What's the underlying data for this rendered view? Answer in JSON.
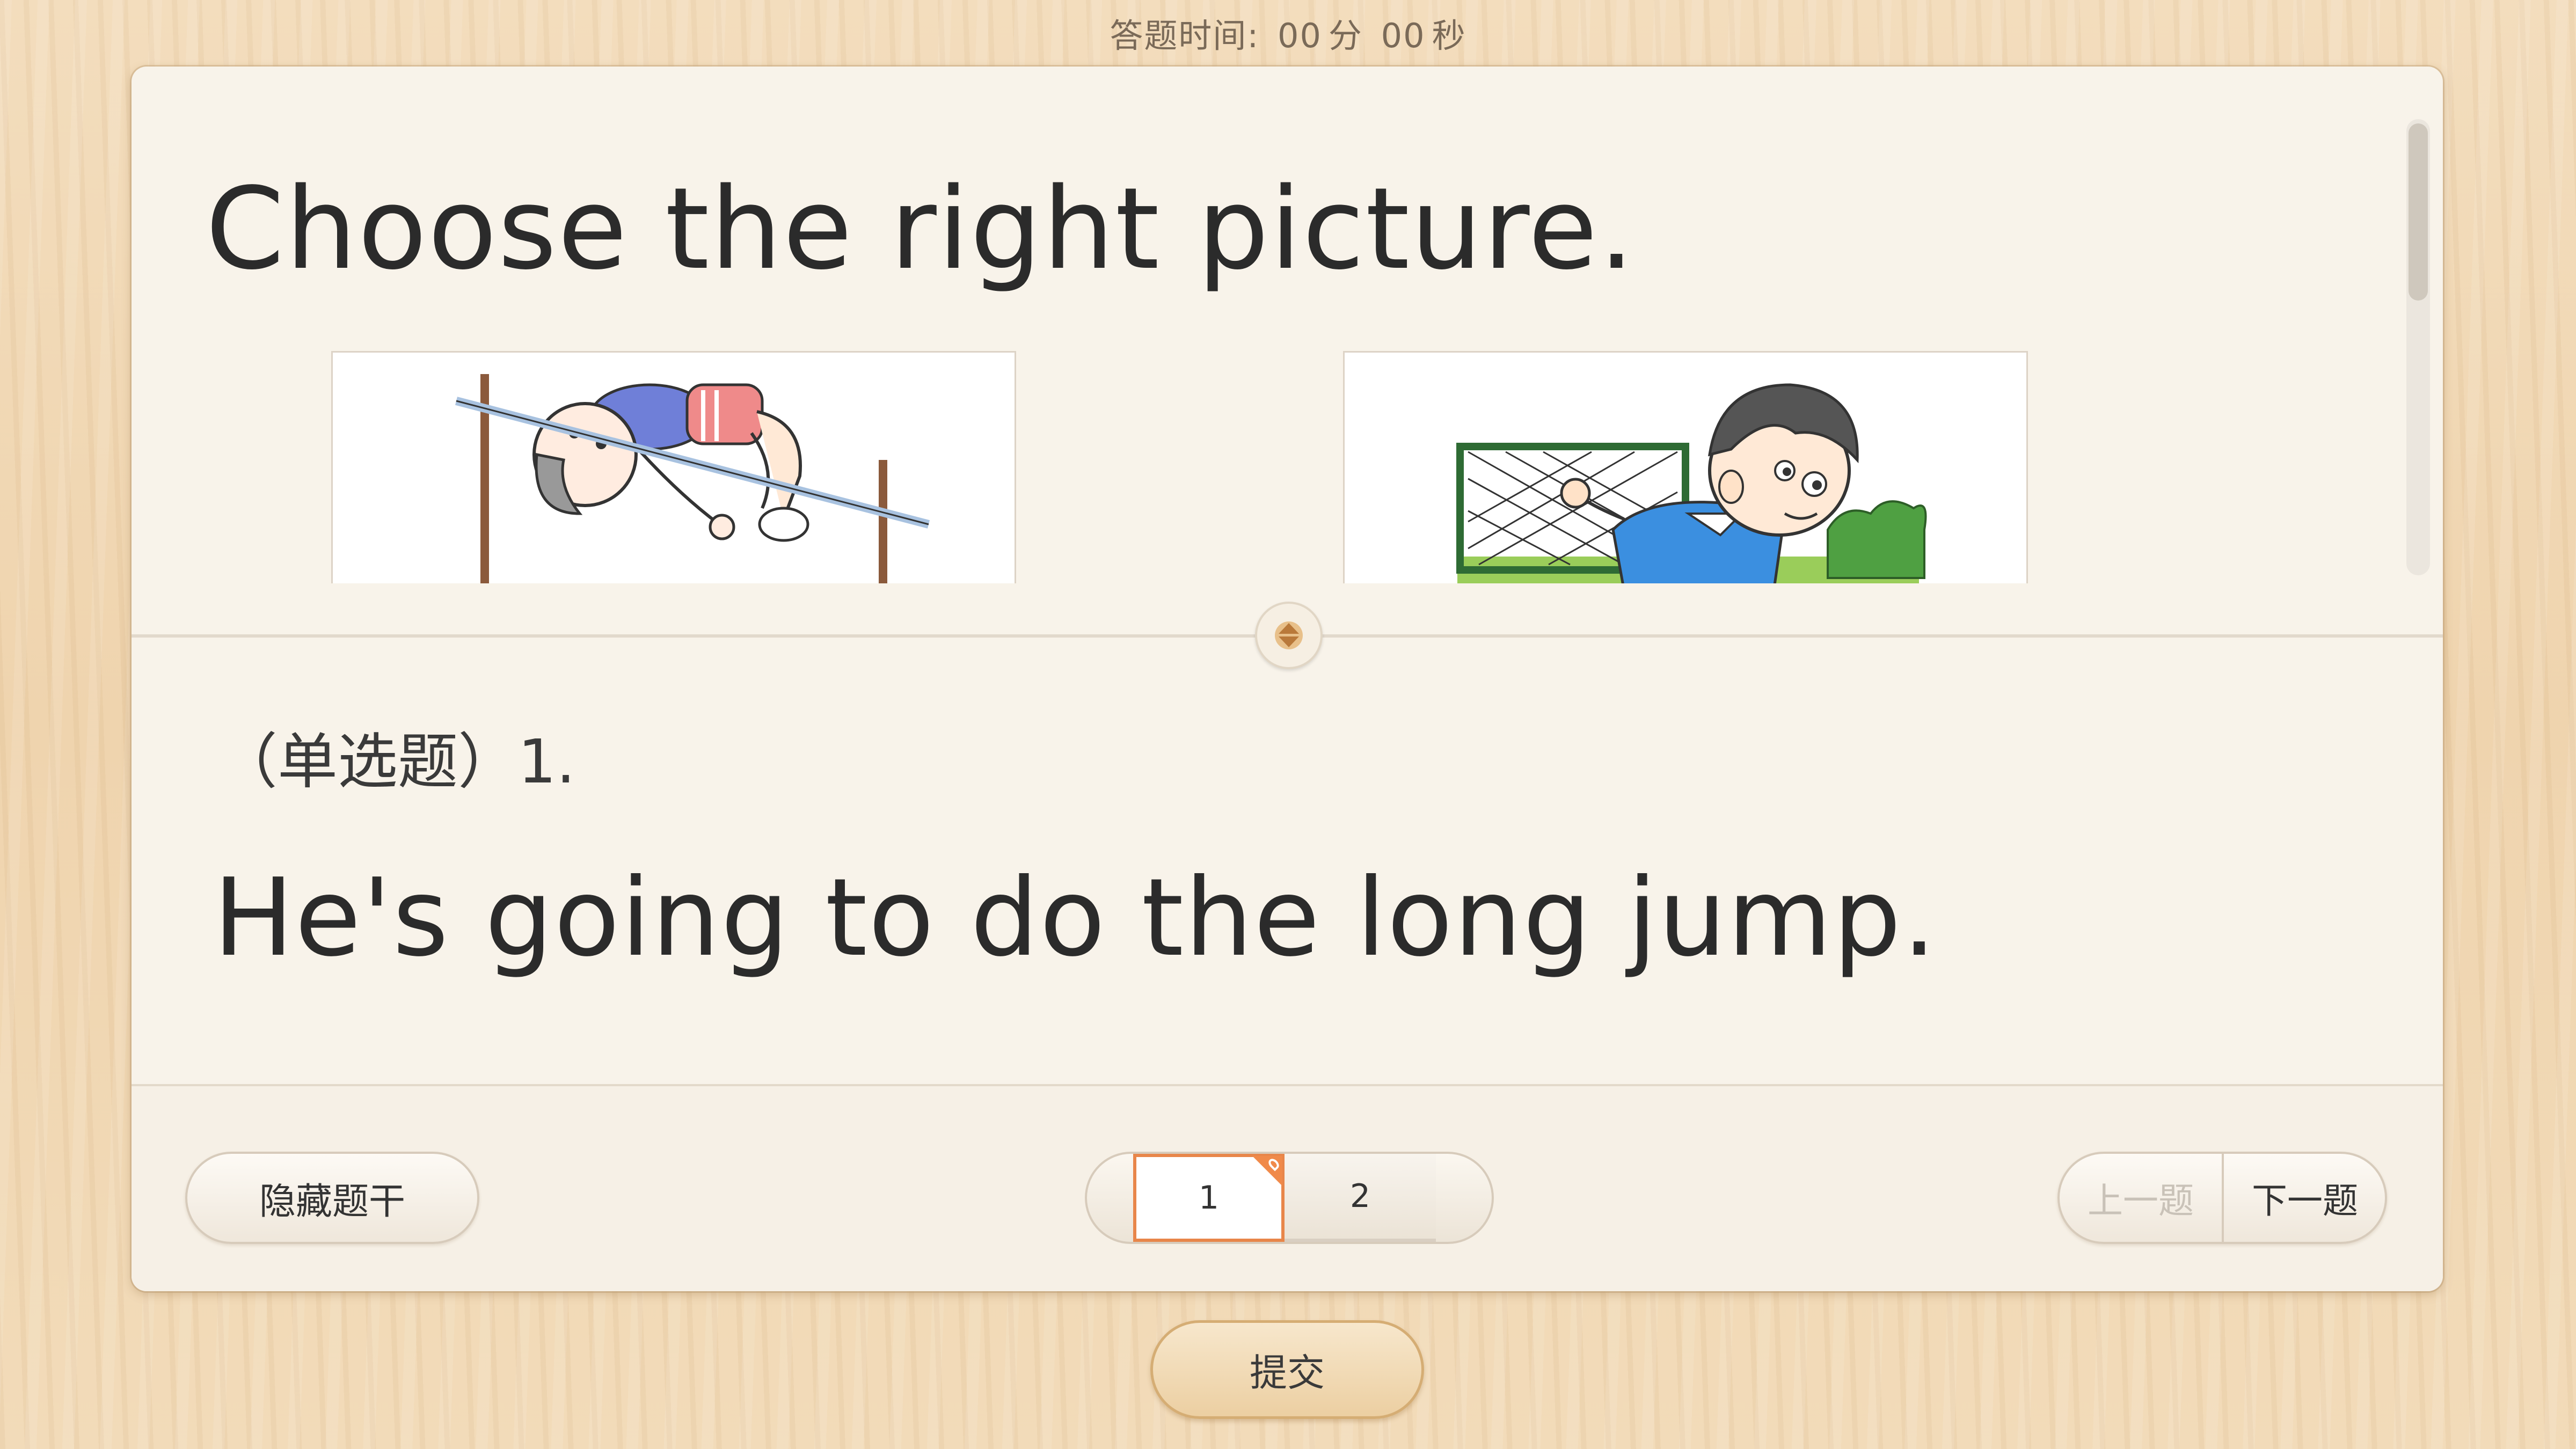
{
  "timer": {
    "label": "答题时间:",
    "minutes": "00",
    "minutes_unit": "分",
    "seconds": "00",
    "seconds_unit": "秒"
  },
  "stem": {
    "title": "Choose the right picture.",
    "pictures": [
      {
        "id": "A",
        "icon": "high-jump-illustration"
      },
      {
        "id": "B",
        "icon": "boy-running-soccer-goal-illustration"
      }
    ]
  },
  "question": {
    "type_label": "（单选题）1.",
    "text": "He's going to do the long jump."
  },
  "footer": {
    "hide_stem_label": "隐藏题干",
    "pages": [
      "1",
      "2"
    ],
    "current_page": "1",
    "prev_label": "上一题",
    "next_label": "下一题"
  },
  "submit_label": "提交",
  "colors": {
    "accent": "#e8864a",
    "panel": "#f8f3ea",
    "background": "#f0d8b4",
    "text": "#2b2b2b"
  }
}
